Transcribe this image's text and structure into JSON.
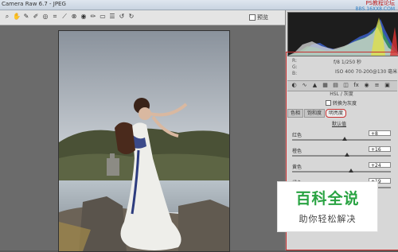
{
  "window": {
    "title": "Camera Raw 6.7 - JPEG"
  },
  "watermark_top": {
    "line1": "PS教程论坛",
    "line2": "BBS.16XX8.COM"
  },
  "toolbar": {
    "tools": [
      "zoom-icon",
      "hand-icon",
      "white-balance-icon",
      "color-sampler-icon",
      "target-adjust-icon",
      "crop-icon",
      "straighten-icon",
      "spot-removal-icon",
      "red-eye-icon",
      "adjustment-brush-icon",
      "graduated-filter-icon",
      "preferences-icon",
      "rotate-left-icon",
      "rotate-right-icon"
    ],
    "preview_label": "预览"
  },
  "readout": {
    "r": "R:",
    "g": "G:",
    "b": "B:",
    "camera_info": "f/8  1/250 秒",
    "iso_info": "ISO 400   70-200@130 毫米"
  },
  "panel": {
    "icons": [
      "basic-icon",
      "tone-curve-icon",
      "detail-icon",
      "hsl-icon",
      "split-toning-icon",
      "lens-icon",
      "effects-icon",
      "camera-calibration-icon",
      "presets-icon",
      "snapshots-icon"
    ],
    "section_title": "HSL / 灰度",
    "convert_gray_label": "转换为灰度",
    "tabs": [
      "色相",
      "饱和度",
      "明亮度"
    ],
    "active_tab": 2,
    "default_link": "默认值",
    "sliders": [
      {
        "label": "红色",
        "value": "+8",
        "level": 0.53
      },
      {
        "label": "橙色",
        "value": "+16",
        "level": 0.56
      },
      {
        "label": "黄色",
        "value": "+24",
        "level": 0.6
      },
      {
        "label": "绿色",
        "value": "+19",
        "level": 0.57
      }
    ]
  },
  "overlay": {
    "big": "百科全说",
    "small": "助你轻松解决"
  },
  "colors": {
    "accent_red": "#c83030",
    "brand_green": "#29a342"
  }
}
